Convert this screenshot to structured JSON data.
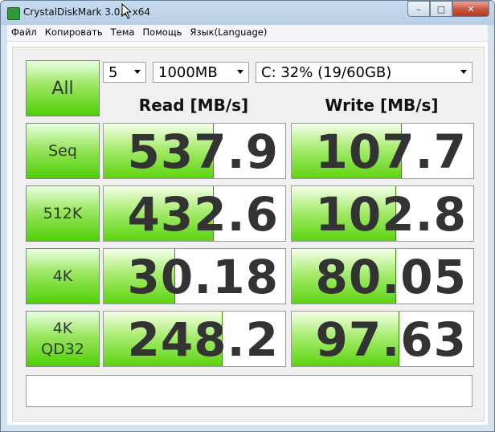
{
  "window": {
    "title": "CrystalDiskMark 3.0.1 x64"
  },
  "menu": [
    "Файл",
    "Копировать",
    "Тема",
    "Помощь",
    "Язык(Language)"
  ],
  "controls": {
    "all_label": "All",
    "count": "5",
    "size": "1000MB",
    "drive": "C: 32% (19/60GB)"
  },
  "headers": {
    "read": "Read [MB/s]",
    "write": "Write [MB/s]"
  },
  "rows": [
    {
      "label": "Seq",
      "read": "537.9",
      "read_fill": 0.6,
      "write": "107.7",
      "write_fill": 0.6
    },
    {
      "label": "512K",
      "read": "432.6",
      "read_fill": 0.6,
      "write": "102.8",
      "write_fill": 0.57
    },
    {
      "label": "4K",
      "read": "30.18",
      "read_fill": 0.39,
      "write": "80.05",
      "write_fill": 0.57
    },
    {
      "label": "4K\nQD32",
      "read": "248.2",
      "read_fill": 0.65,
      "write": "97.63",
      "write_fill": 0.59
    }
  ],
  "colors": {
    "accent_green": "#4fcf05",
    "close_red": "#c6543c"
  },
  "icons": {
    "window_controls": [
      "minimize-icon",
      "maximize-icon",
      "close-icon"
    ]
  }
}
